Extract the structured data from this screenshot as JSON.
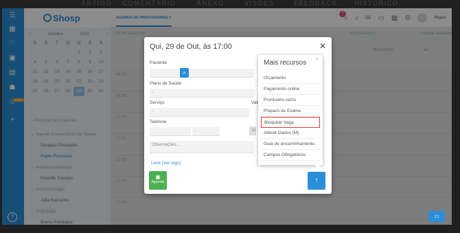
{
  "top_nav": [
    "ARTIGO",
    "COMENTÁRIO",
    "ANEXO",
    "VISÕES",
    "FEEDBACK",
    "HISTÓRICO"
  ],
  "logo": "Shosp",
  "header": {
    "active_tab": "AGENDA DE PRESTADORES",
    "notif_count": "7",
    "user": "Miguel"
  },
  "calendar": {
    "month": "Outubro",
    "year": "2020",
    "weekdays": [
      "D",
      "S",
      "T",
      "Q",
      "Q",
      "S",
      "S"
    ],
    "days": [
      "",
      "",
      "",
      "",
      "1",
      "2",
      "3",
      "4",
      "5",
      "6",
      "7",
      "8",
      "9",
      "10",
      "11",
      "12",
      "13",
      "14",
      "15",
      "16",
      "17",
      "18",
      "19",
      "20",
      "21",
      "22",
      "23",
      "24",
      "25",
      "26",
      "27",
      "28",
      "29",
      "30",
      "31"
    ],
    "selected_index": 32
  },
  "sidebar": {
    "search_placeholder": "Procurar prestadores",
    "tree": [
      {
        "type": "grp",
        "label": "Agente Comunitário De Saúde"
      },
      {
        "type": "itm",
        "label": "Douglas Prestador"
      },
      {
        "type": "itm",
        "label": "Pablo Prestador",
        "active": true
      },
      {
        "type": "grp",
        "label": "Anatomopatologia"
      },
      {
        "type": "itm",
        "label": "Rodolfo Canedo"
      },
      {
        "type": "grp",
        "label": "Anestesiologia"
      },
      {
        "type": "itm",
        "label": "Júlia Barcellos"
      },
      {
        "type": "grp",
        "label": "Angiologia"
      },
      {
        "type": "itm",
        "label": "Breno Prestador"
      }
    ]
  },
  "modal": {
    "title": "Qui, 29 de Out, às 17:00",
    "paciente_label": "Paciente",
    "plano_label": "Plano de Saúde",
    "servico_label": "Serviço",
    "valor_label": "Valo",
    "telefone_label": "Telefone",
    "observacoes_placeholder": "Observações...",
    "livre_link": "Livre",
    "ver_logs_link": "[Ver logs]",
    "agendar_label": "Agendar",
    "select_placeholder": "-"
  },
  "popover": {
    "title": "Mais recursos",
    "items": [
      "Orçamento",
      "Pagamento online",
      "Prontuário vazio",
      "Preparo de Exame",
      "Bloquear Vaga",
      "Alterar Dados (M)",
      "Guia de encaminhamento",
      "Campos Obrigatórios"
    ],
    "highlighted": "Bloquear Vaga"
  },
  "grid": {
    "times": [
      "04:10",
      "04:30",
      "17:00",
      "17:01",
      "17:02",
      "17:03",
      "17:04"
    ]
  },
  "toolbar": {
    "clinic_label": "CLÍNICA SHOSP",
    "honorarios": "HONORÁRIOS",
    "fila": "FILA DE ESPERA",
    "recepcao": "RECEPÇÃO",
    "dia": "dia"
  }
}
